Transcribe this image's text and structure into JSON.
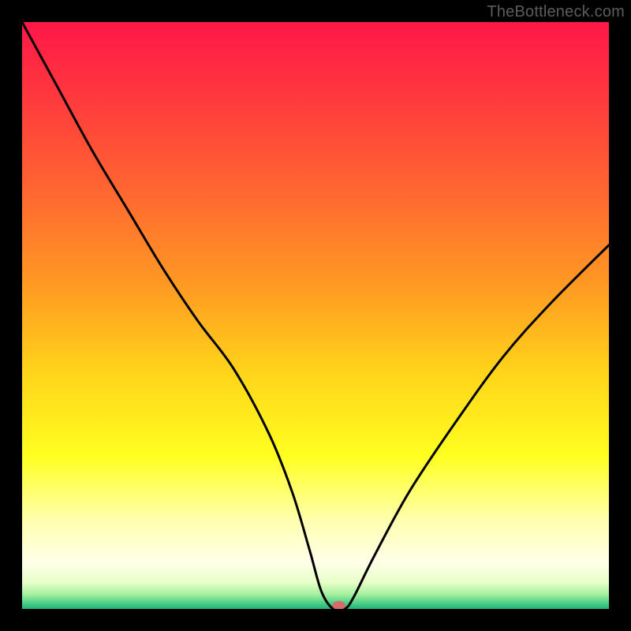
{
  "attribution": "TheBottleneck.com",
  "colors": {
    "gradient_stops": [
      {
        "offset": 0,
        "color": "#ff1749"
      },
      {
        "offset": 0.14,
        "color": "#ff3c3c"
      },
      {
        "offset": 0.3,
        "color": "#ff6a30"
      },
      {
        "offset": 0.45,
        "color": "#ff9a22"
      },
      {
        "offset": 0.6,
        "color": "#ffd51a"
      },
      {
        "offset": 0.74,
        "color": "#ffff20"
      },
      {
        "offset": 0.85,
        "color": "#ffffb0"
      },
      {
        "offset": 0.92,
        "color": "#ffffe8"
      },
      {
        "offset": 0.955,
        "color": "#e8ffc8"
      },
      {
        "offset": 0.975,
        "color": "#a6f0a0"
      },
      {
        "offset": 0.988,
        "color": "#5ad48a"
      },
      {
        "offset": 1.0,
        "color": "#1fb37d"
      }
    ],
    "curve": "#000000",
    "marker": "#d86a6a",
    "attribution": "#5c5c5c"
  },
  "chart_data": {
    "type": "line",
    "title": "",
    "xlabel": "",
    "ylabel": "",
    "xlim": [
      0,
      100
    ],
    "ylim": [
      0,
      100
    ],
    "grid": false,
    "legend": false,
    "series": [
      {
        "name": "bottleneck-curve",
        "x": [
          0,
          6,
          12,
          18,
          24,
          30,
          36,
          42,
          46,
          49,
          51,
          53,
          55,
          56.5,
          60,
          66,
          74,
          82,
          90,
          100
        ],
        "values": [
          100,
          89,
          78,
          68,
          58,
          49,
          41,
          30,
          20,
          10,
          3,
          0,
          0,
          2,
          9,
          20,
          32,
          43,
          52,
          62
        ]
      }
    ],
    "markers": [
      {
        "name": "optimal-point",
        "x": 54,
        "y": 0
      }
    ],
    "notes": "Axes are unlabeled in the source image; x/y values are estimated from pixel positions on a 0–100 normalized scale. Lower y = better (closer to green)."
  }
}
